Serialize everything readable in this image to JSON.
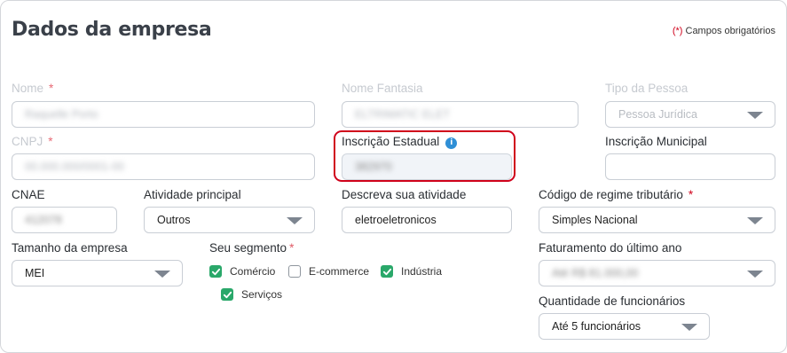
{
  "header": {
    "title": "Dados da empresa",
    "required_asterisk": "(*)",
    "required_text": "Campos obrigatórios"
  },
  "fields": {
    "nome": {
      "label": "Nome",
      "star": "*",
      "value": "Raquelle Porto"
    },
    "nome_fantasia": {
      "label": "Nome Fantasia",
      "value": "ELTRIMATIC ELET"
    },
    "tipo_pessoa": {
      "label": "Tipo da Pessoa",
      "value": "Pessoa Jurídica"
    },
    "cnpj": {
      "label": "CNPJ",
      "star": "*",
      "value": "00.000.000/0001-00"
    },
    "inscricao_estadual": {
      "label": "Inscrição Estadual",
      "info_icon": "i",
      "value": "382970"
    },
    "inscricao_municipal": {
      "label": "Inscrição Municipal",
      "value": ""
    },
    "cnae": {
      "label": "CNAE",
      "value": "412078"
    },
    "atividade_principal": {
      "label": "Atividade principal",
      "value": "Outros"
    },
    "descreva_atividade": {
      "label": "Descreva sua atividade",
      "value": "eletroeletronicos"
    },
    "regime_tributario": {
      "label": "Código de regime tributário",
      "star": "*",
      "value": "Simples Nacional"
    },
    "tamanho_empresa": {
      "label": "Tamanho da empresa",
      "value": "MEI"
    },
    "segmento": {
      "label": "Seu segmento",
      "star": "*",
      "options": [
        {
          "label": "Comércio",
          "checked": true
        },
        {
          "label": "E-commerce",
          "checked": false
        },
        {
          "label": "Indústria",
          "checked": true
        },
        {
          "label": "Serviços",
          "checked": true
        }
      ]
    },
    "faturamento": {
      "label": "Faturamento do último ano",
      "value": "Até R$ 81.000,00"
    },
    "funcionarios": {
      "label": "Quantidade de funcionários",
      "value": "Até 5 funcionários"
    }
  },
  "colors": {
    "required": "#d0021b",
    "checkbox_checked": "#2aa86a",
    "info": "#2f8fd6",
    "highlight": "#d0021b"
  },
  "icons": {
    "select_caret": "chevron-down-icon",
    "checkmark": "checkmark-icon",
    "info": "info-icon"
  }
}
